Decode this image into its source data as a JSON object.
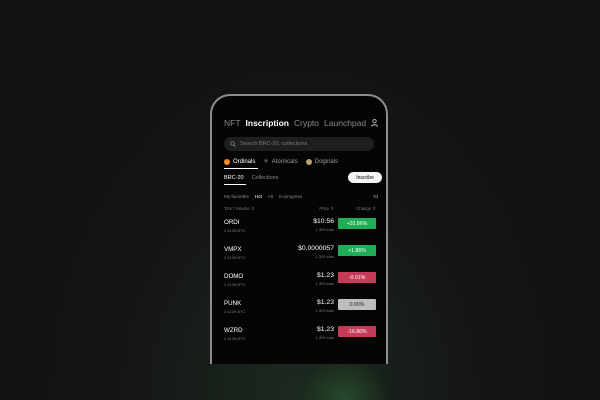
{
  "colors": {
    "up": "#1fae55",
    "down": "#c63b58",
    "flat": "#bdbdbd",
    "ordinals": "#f28a2b",
    "doginals": "#b5a46a"
  },
  "nav": {
    "tabs": [
      "NFT",
      "Inscription",
      "Crypto",
      "Launchpad"
    ],
    "active_index": 1
  },
  "search": {
    "placeholder": "Search BRC-20, collections"
  },
  "chains": [
    {
      "label": "Ordinals",
      "icon": "ordinals-icon"
    },
    {
      "label": "Atomicals",
      "icon": "atomicals-icon"
    },
    {
      "label": "Doginals",
      "icon": "doginals-icon"
    }
  ],
  "subtabs": {
    "brc20": "BRC-20",
    "collections": "Collections",
    "inscribe": "Inscribe"
  },
  "filters": {
    "items": [
      "My favorites",
      "Hot",
      "All",
      "In-progress"
    ],
    "period": "7d"
  },
  "table": {
    "headers": {
      "tick": "Tick / Volume ⇕",
      "price": "Price ⇕",
      "change": "Change ⇕"
    },
    "rows": [
      {
        "tick": "ORDI",
        "volume": "2.4126 BTC",
        "price": "$10.56",
        "sats": "1,399 sats",
        "change": "+32.86%",
        "direction": "up"
      },
      {
        "tick": "VMPX",
        "volume": "2.4126 BTC",
        "price": "$0.0000057",
        "sats": "1,399 sats",
        "change": "+1.86%",
        "direction": "up"
      },
      {
        "tick": "DOMO",
        "volume": "2.4126 BTC",
        "price": "$1.23",
        "sats": "1,399 sats",
        "change": "-0.01%",
        "direction": "down"
      },
      {
        "tick": "PUNK",
        "volume": "2.4126 BTC",
        "price": "$1.23",
        "sats": "1,399 sats",
        "change": "0.00%",
        "direction": "flat"
      },
      {
        "tick": "WZRD",
        "volume": "2.4126 BTC",
        "price": "$1.23",
        "sats": "1,399 sats",
        "change": "-16.86%",
        "direction": "down"
      }
    ]
  }
}
